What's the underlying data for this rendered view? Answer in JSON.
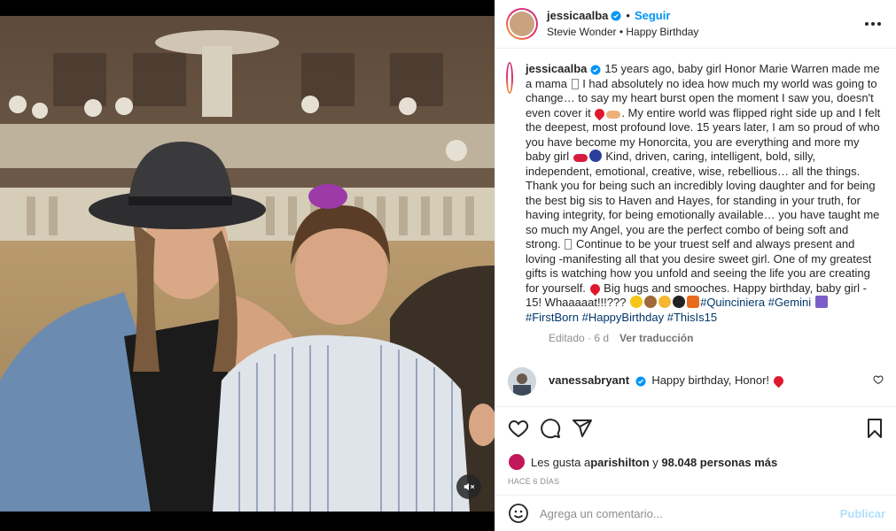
{
  "post": {
    "username": "jessicaalba",
    "follow_label": "Seguir",
    "separator": "•",
    "audio_artist": "Stevie Wonder",
    "audio_sep": "•",
    "audio_title": "Happy Birthday",
    "caption_parts": {
      "p1": "15 years ago, baby girl Honor Marie Warren made me a mama ",
      "p2": " I had absolutely no idea how much my world was going to change… to say my heart burst open the moment I saw you, doesn't even cover it ",
      "p3": ". My entire world was flipped right side up and I felt the deepest, most profound love. 15 years later, I am so proud of who you have become my Honorcita, you are everything and more my baby girl ",
      "p4": " Kind, driven, caring, intelligent, bold, silly, independent, emotional, creative, wise, rebellious… all the things. Thank you for being such an incredibly loving daughter and for being the best big sis to Haven and Hayes, for standing in your truth, for having integrity, for being emotionally available… you have taught me so much my Angel, you are the perfect combo of being soft and strong. ",
      "p5": " Continue to be your truest self and always present and loving -manifesting all that you desire sweet girl. One of my greatest gifts is watching how you unfold and seeing the life you are creating for yourself. ",
      "p6": " Big hugs and smooches. Happy birthday, baby girl - 15! Whaaaaat!!!??? "
    },
    "hashtags": [
      "#Quinciniera",
      "#Gemini",
      "#FirstBorn",
      "#HappyBirthday",
      "#ThisIs15"
    ],
    "edited_label": "Editado · 6 d",
    "translate_label": "Ver traducción"
  },
  "comments": [
    {
      "username": "vanessabryant",
      "text": "Happy birthday, Honor! "
    }
  ],
  "likes": {
    "prefix": "Les gusta a ",
    "first_user": "parishilton",
    "middle": " y ",
    "count": "98.048 personas más"
  },
  "time_ago": "Hace 6 días",
  "composer": {
    "placeholder": "Agrega un comentario...",
    "publish_label": "Publicar"
  },
  "colors": {
    "accent": "#0095f6",
    "hashtag": "#00376b",
    "muted": "#8e8e8e",
    "heart": "#ed4956"
  },
  "icons": [
    "verified-badge-icon",
    "more-options-icon",
    "heart-icon",
    "comment-icon",
    "share-icon",
    "save-icon",
    "emoji-icon",
    "mute-icon"
  ]
}
